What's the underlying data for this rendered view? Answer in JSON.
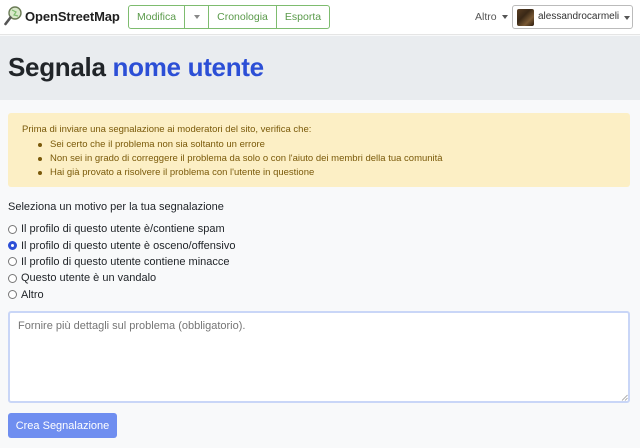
{
  "header": {
    "brand": "OpenStreetMap",
    "edit_label": "Modifica",
    "history_label": "Cronologia",
    "export_label": "Esporta",
    "more_label": "Altro",
    "username": "alessandrocarmeli"
  },
  "title": {
    "prefix": "Segnala",
    "subject": "nome utente"
  },
  "warning": {
    "intro": "Prima di inviare una segnalazione ai moderatori del sito, verifica che:",
    "items": [
      "Sei certo che il problema non sia soltanto un errore",
      "Non sei in grado di correggere il problema da solo o con l'aiuto dei membri della tua comunità",
      "Hai già provato a risolvere il problema con l'utente in questione"
    ]
  },
  "form": {
    "prompt": "Seleziona un motivo per la tua segnalazione",
    "options": [
      {
        "label": "Il profilo di questo utente è/contiene spam",
        "checked": false
      },
      {
        "label": "Il profilo di questo utente è osceno/offensivo",
        "checked": true
      },
      {
        "label": "Il profilo di questo utente contiene minacce",
        "checked": false
      },
      {
        "label": "Questo utente è un vandalo",
        "checked": false
      },
      {
        "label": "Altro",
        "checked": false
      }
    ],
    "details_placeholder": "Fornire più dettagli sul problema (obbligatorio).",
    "submit_label": "Crea Segnalazione"
  },
  "colors": {
    "accent": "#2c4fd6",
    "osm_green": "#7ebc6f",
    "warning_bg": "#fcefc5",
    "submit_bg": "#6f8ef0"
  },
  "icons": {
    "logo": "osm-magnifier-logo-icon",
    "dropdown": "chevron-down-icon",
    "avatar": "user-avatar"
  }
}
